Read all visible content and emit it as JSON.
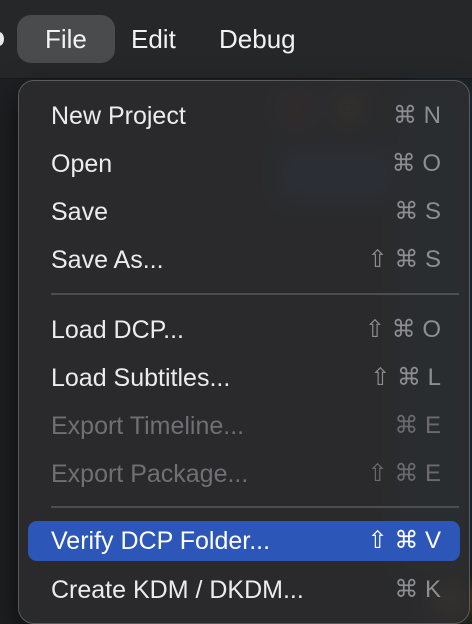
{
  "menubar": {
    "items": [
      {
        "label": "File",
        "active": true
      },
      {
        "label": "Edit",
        "active": false
      },
      {
        "label": "Debug",
        "active": false
      }
    ]
  },
  "file_menu": {
    "groups": [
      [
        {
          "label": "New Project",
          "shortcut": "⌘ N",
          "enabled": true
        },
        {
          "label": "Open",
          "shortcut": "⌘ O",
          "enabled": true
        },
        {
          "label": "Save",
          "shortcut": "⌘ S",
          "enabled": true
        },
        {
          "label": "Save As...",
          "shortcut": "⇧ ⌘ S",
          "enabled": true
        }
      ],
      [
        {
          "label": "Load DCP...",
          "shortcut": "⇧ ⌘ O",
          "enabled": true
        },
        {
          "label": "Load Subtitles...",
          "shortcut": "⇧ ⌘ L",
          "enabled": true
        },
        {
          "label": "Export Timeline...",
          "shortcut": "⌘ E",
          "enabled": false
        },
        {
          "label": "Export Package...",
          "shortcut": "⇧ ⌘ E",
          "enabled": false
        }
      ],
      [
        {
          "label": "Verify DCP Folder...",
          "shortcut": "⇧ ⌘ V",
          "enabled": true,
          "highlighted": true
        },
        {
          "label": "Create KDM / DKDM...",
          "shortcut": "⌘ K",
          "enabled": true
        }
      ]
    ]
  },
  "colors": {
    "highlight": "#2c57b8",
    "menu_bg": "#2c2c2e"
  }
}
